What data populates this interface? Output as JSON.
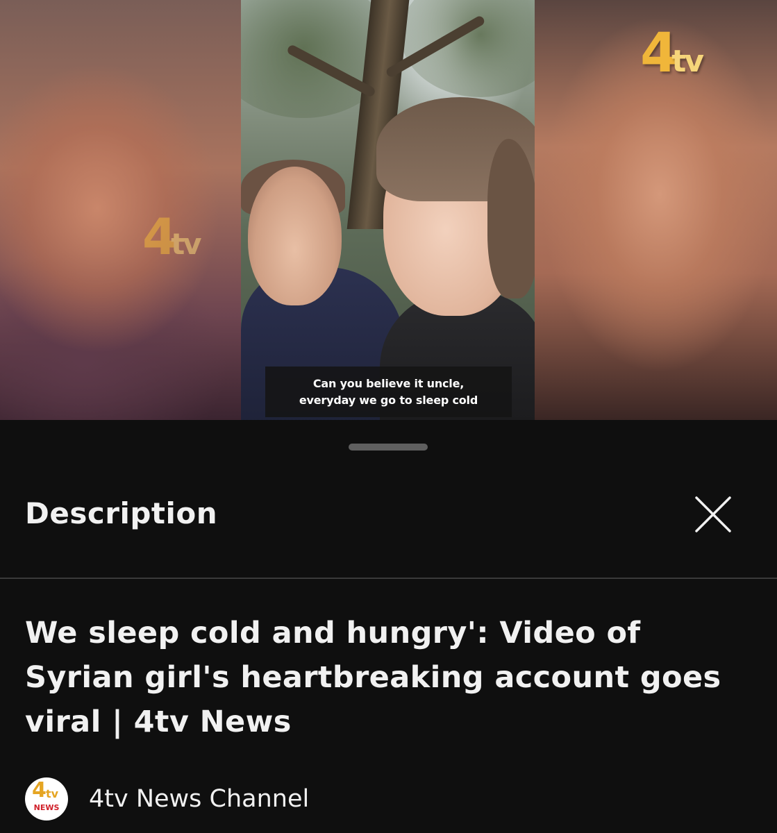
{
  "video": {
    "caption_line1": "Can you believe it uncle,",
    "caption_line2": "everyday we go to sleep cold",
    "logo": {
      "four": "4",
      "tv": "tv"
    },
    "watermark": {
      "four": "4",
      "tv": "tv"
    }
  },
  "sheet": {
    "title": "Description",
    "close_icon": "close-icon",
    "video_title": "We sleep cold and hungry': Video of Syrian girl's heartbreaking account goes viral | 4tv News",
    "channel": {
      "name": "4tv News Channel",
      "avatar": {
        "four": "4",
        "tv": "tv",
        "news": "NEWS"
      }
    }
  },
  "colors": {
    "background": "#0f0f0f",
    "text": "#f1f1f1",
    "divider": "#3a3a3a",
    "handle": "#5f5f5f",
    "brand_gold": "#f0b63a",
    "brand_red": "#d0202a"
  }
}
